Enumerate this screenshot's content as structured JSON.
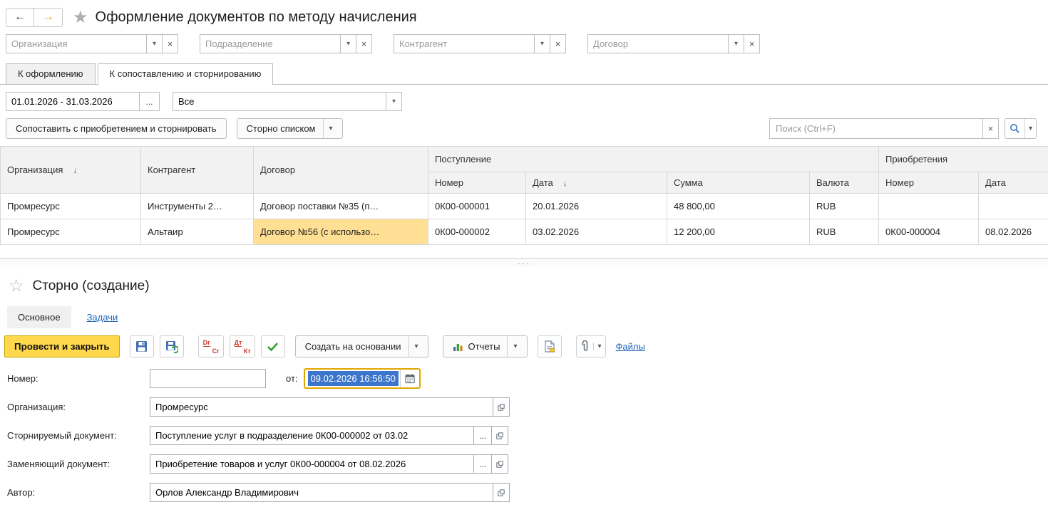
{
  "colors": {
    "accent_yellow": "#ffd84b",
    "focus_gold": "#dfa700",
    "row_selected": "#ffeebb",
    "cell_current": "#ffdf93",
    "link_blue": "#2266bb",
    "selection_blue": "#3b76cc"
  },
  "icons": {
    "back": "←",
    "forward": "→",
    "star": "★",
    "star_outline": "☆",
    "caret_down": "▾",
    "clear": "×",
    "ellipsis": "...",
    "sort_desc": "↓",
    "grip_dots": "···"
  },
  "topbar": {
    "title": "Оформление документов по методу начисления"
  },
  "filters": {
    "organization": "Организация",
    "department": "Подразделение",
    "contragent": "Контрагент",
    "contract": "Договор"
  },
  "main_tabs": {
    "registration": "К оформлению",
    "matching": "К сопоставлению и сторнированию"
  },
  "period": {
    "range": "01.01.2026 - 31.03.2026",
    "mode": "Все"
  },
  "actions": {
    "match_button": "Сопоставить с приобретением и сторнировать",
    "storno_list_button": "Сторно списком",
    "search_placeholder": "Поиск (Ctrl+F)"
  },
  "table": {
    "headers": {
      "org": "Организация",
      "contragent": "Контрагент",
      "contract": "Договор",
      "receipt_group": "Поступление",
      "acq_group": "Приобретения",
      "number": "Номер",
      "date": "Дата",
      "sum": "Сумма",
      "currency": "Валюта",
      "acq_number": "Номер",
      "acq_date": "Дата"
    },
    "rows": [
      {
        "org": "Промресурс",
        "contragent": "Инструменты 2…",
        "contract": "Договор поставки №35  (п…",
        "num": "0К00-000001",
        "date": "20.01.2026",
        "sum": "48 800,00",
        "currency": "RUB",
        "acq_num": "",
        "acq_date": ""
      },
      {
        "org": "Промресурс",
        "contragent": "Альтаир",
        "contract": "Договор №56 (с использо…",
        "num": "0К00-000002",
        "date": "03.02.2026",
        "sum": "12 200,00",
        "currency": "RUB",
        "acq_num": "0К00-000004",
        "acq_date": "08.02.2026"
      }
    ]
  },
  "detail": {
    "title": "Сторно (создание)",
    "tabs": {
      "main": "Основное",
      "tasks": "Задачи"
    },
    "toolbar": {
      "post_close": "Провести и закрыть",
      "create_from": "Создать на основании",
      "reports": "Отчеты",
      "files": "Файлы",
      "dr": "Dr",
      "cr": "Cr",
      "dt": "Дт",
      "kt": "Кт"
    },
    "form": {
      "number_label": "Номер:",
      "number_value": "",
      "from_label": "от:",
      "datetime": "09.02.2026 16:56:50",
      "org_label": "Организация:",
      "org_value": "Промресурс",
      "storno_label": "Сторнируемый документ:",
      "storno_value": "Поступление услуг в подразделение 0К00-000002 от 03.02",
      "replace_label": "Заменяющий документ:",
      "replace_value": "Приобретение товаров и услуг 0К00-000004 от 08.02.2026",
      "author_label": "Автор:",
      "author_value": "Орлов Александр Владимирович"
    }
  }
}
